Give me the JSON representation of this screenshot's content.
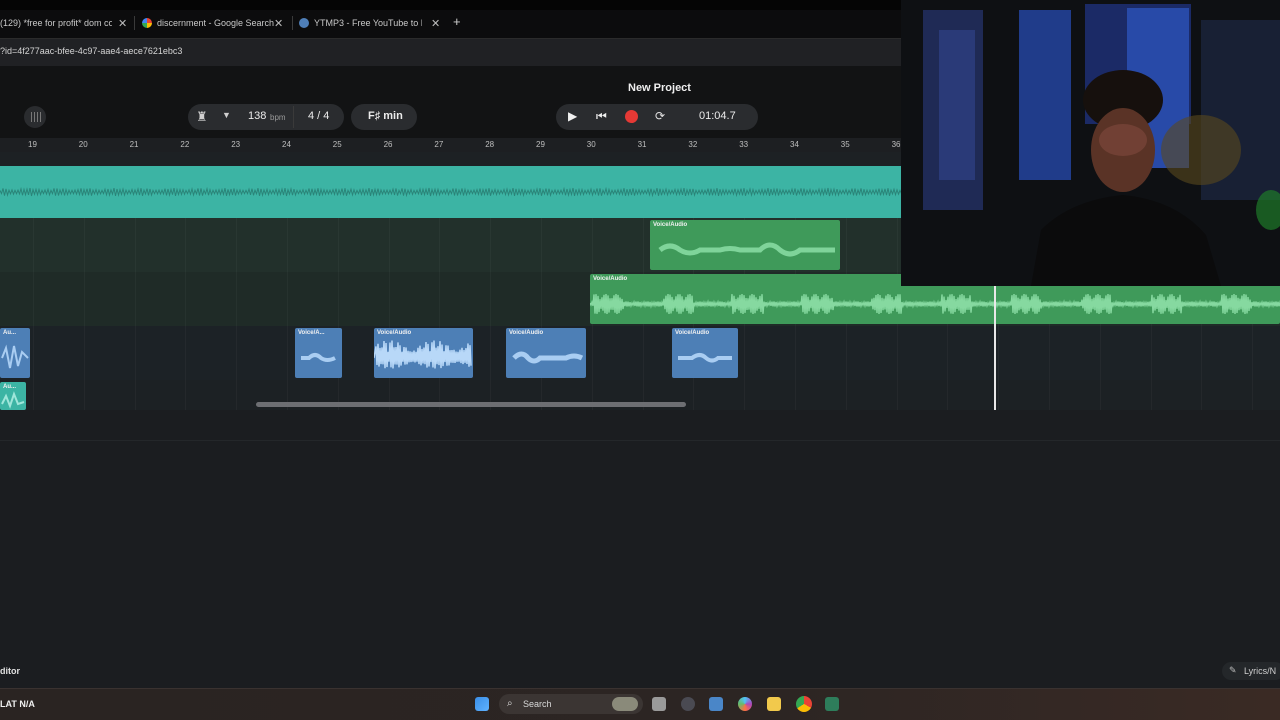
{
  "browser": {
    "tabs": [
      {
        "title": "(129) *free for profit* dom corle"
      },
      {
        "title": "discernment - Google Search"
      },
      {
        "title": "YTMP3 - Free YouTube to MP3"
      }
    ],
    "url": "?id=4f277aac-bfee-4c97-aae4-aece7621ebc3"
  },
  "app": {
    "project_title": "New Project",
    "bpm": "138",
    "bpm_unit": "bpm",
    "time_signature": "4 / 4",
    "key": "F♯ min",
    "time": "01:04.7",
    "editor_label": "ditor",
    "lyrics_label": "Lyrics/N"
  },
  "ruler": {
    "bars": [
      "19",
      "20",
      "21",
      "22",
      "23",
      "24",
      "25",
      "26",
      "27",
      "28",
      "29",
      "30",
      "31",
      "32",
      "33",
      "34",
      "35",
      "36"
    ]
  },
  "tracks": {
    "clip_green_1": "Voice/Audio",
    "clip_green_2": "Voice/Audio",
    "clip_blue_0": "Au...",
    "clip_blue_1": "Voice/A...",
    "clip_blue_2": "Voice/Audio",
    "clip_blue_3": "Voice/Audio",
    "clip_blue_4": "Voice/Audio",
    "clip_small": "Au..."
  },
  "taskbar": {
    "status": "LAT  N/A",
    "search_placeholder": "Search"
  },
  "colors": {
    "teal": "#3cb4a4",
    "green": "#3f9a5a",
    "blue": "#4d7fb6",
    "record": "#e53935"
  }
}
